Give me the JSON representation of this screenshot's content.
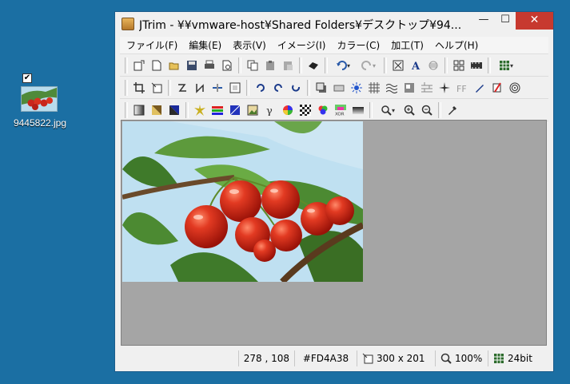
{
  "desktop": {
    "icon_label": "9445822.jpg",
    "check_mark": "✔"
  },
  "window": {
    "title": "JTrim - ¥¥vmware-host¥Shared Folders¥デスクトップ¥94...",
    "min_glyph": "—",
    "max_glyph": "☐",
    "close_glyph": "✕"
  },
  "menu": [
    {
      "label": "ファイル(F)"
    },
    {
      "label": "編集(E)"
    },
    {
      "label": "表示(V)"
    },
    {
      "label": "イメージ(I)"
    },
    {
      "label": "カラー(C)"
    },
    {
      "label": "加工(T)"
    },
    {
      "label": "ヘルプ(H)"
    }
  ],
  "status": {
    "coords": "278 , 108",
    "color": "#FD4A38",
    "size": "300 x 201",
    "zoom": "100%",
    "depth": "24bit"
  },
  "colors": {
    "desktop": "#1b6fa3",
    "close_button": "#c7392f",
    "canvas": "#a5a5a5"
  }
}
